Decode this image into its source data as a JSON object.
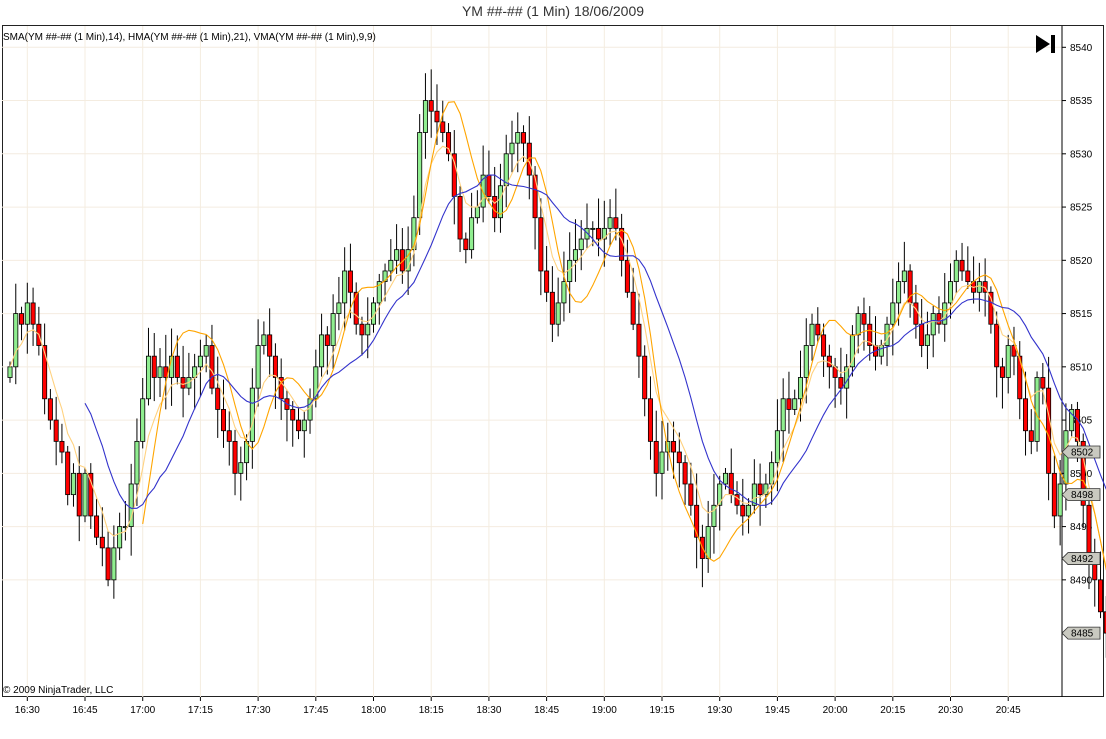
{
  "window": {
    "title": "YM ##-## (1 Min)  18/06/2009"
  },
  "legend_text": "SMA(YM ##-## (1 Min),14), HMA(YM ##-## (1 Min),21), VMA(YM ##-## (1 Min),9,9)",
  "copyright": "© 2009 NinjaTrader, LLC",
  "toolbar": {
    "scroll_end_icon": "skip-to-end-icon"
  },
  "colors": {
    "up_candle": "#90ee90",
    "down_candle": "#ff0000",
    "sma": "#3333cc",
    "hma": "#ffa500",
    "vma": "#ffd280",
    "grid": "#f4ece0",
    "price_tag_fill": "#c9c9c0"
  },
  "chart_data": {
    "type": "candlestick",
    "title": "YM ##-## (1 Min)  18/06/2009",
    "x_tick_labels": [
      "16:30",
      "16:45",
      "17:00",
      "17:15",
      "17:30",
      "17:45",
      "18:00",
      "18:15",
      "18:30",
      "18:45",
      "19:00",
      "19:15",
      "19:30",
      "19:45",
      "20:00",
      "20:15",
      "20:30",
      "20:45"
    ],
    "y_tick_labels": [
      "8540",
      "8535",
      "8530",
      "8525",
      "8520",
      "8515",
      "8510",
      "8505",
      "8500",
      "8495",
      "8490"
    ],
    "ylim": [
      8479,
      8542
    ],
    "grid": true,
    "price_tags": [
      "8502",
      "8498",
      "8492",
      "8485"
    ],
    "bar_interval": "1 Min",
    "closes": [
      8510,
      8515,
      8514,
      8516,
      8514,
      8512,
      8507,
      8505,
      8503,
      8502,
      8498,
      8500,
      8496,
      8500,
      8496,
      8494,
      8493,
      8490,
      8493,
      8495,
      8495,
      8499,
      8503,
      8507,
      8511,
      8509,
      8510,
      8509,
      8511,
      8509,
      8508,
      8509,
      8510,
      8511,
      8512,
      8508,
      8506,
      8504,
      8503,
      8500,
      8501,
      8503,
      8508,
      8512,
      8513,
      8511,
      8509,
      8507,
      8506,
      8505,
      8504,
      8505,
      8507,
      8510,
      8513,
      8512,
      8515,
      8516,
      8519,
      8517,
      8514,
      8513,
      8514,
      8516,
      8518,
      8519,
      8520,
      8521,
      8519,
      8521,
      8524,
      8532,
      8535,
      8534,
      8533,
      8532,
      8530,
      8526,
      8522,
      8521,
      8524,
      8525,
      8528,
      8526,
      8524,
      8527,
      8530,
      8531,
      8532,
      8531,
      8528,
      8524,
      8519,
      8517,
      8514,
      8516,
      8518,
      8520,
      8521,
      8522,
      8523,
      8523,
      8522,
      8523,
      8524,
      8523,
      8520,
      8517,
      8514,
      8511,
      8507,
      8503,
      8500,
      8502,
      8503,
      8502,
      8501,
      8499,
      8497,
      8494,
      8492,
      8495,
      8497,
      8499,
      8500,
      8498,
      8497,
      8496,
      8497,
      8499,
      8498,
      8499,
      8501,
      8504,
      8507,
      8506,
      8507,
      8509,
      8512,
      8514,
      8513,
      8511,
      8510,
      8509,
      8508,
      8510,
      8513,
      8515,
      8514,
      8512,
      8511,
      8512,
      8514,
      8516,
      8518,
      8519,
      8516,
      8514,
      8512,
      8513,
      8515,
      8514,
      8516,
      8518,
      8520,
      8519,
      8518,
      8517,
      8518,
      8517,
      8514,
      8510,
      8509,
      8512,
      8511,
      8507,
      8504,
      8503,
      8509,
      8508,
      8500,
      8496,
      8499,
      8504,
      8506,
      8503,
      8497,
      8492,
      8490,
      8487,
      8485
    ]
  }
}
